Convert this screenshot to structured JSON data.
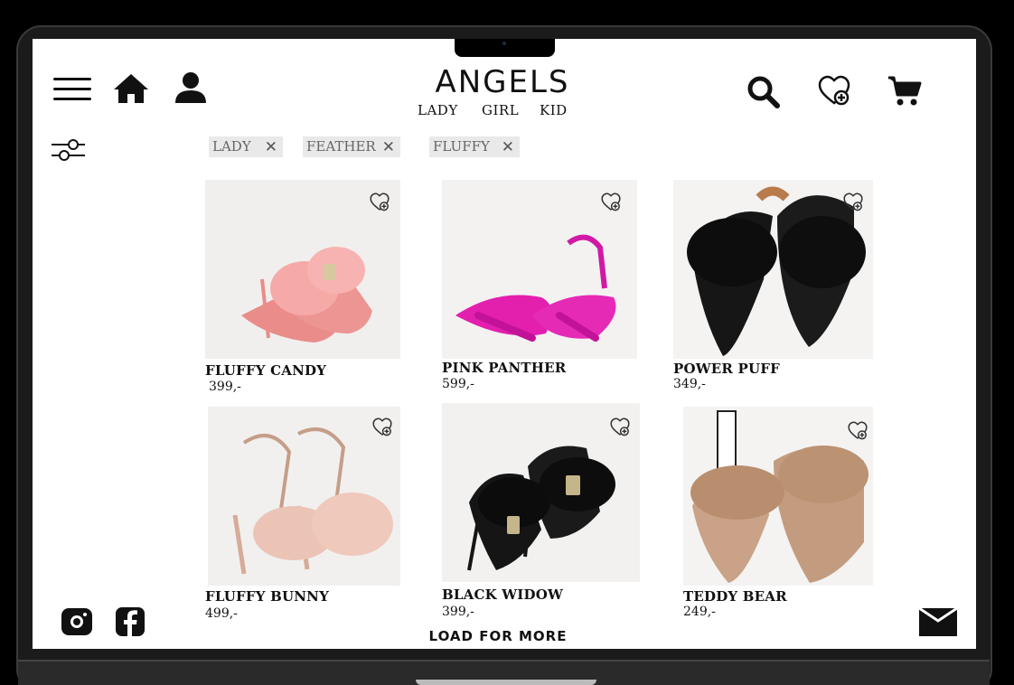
{
  "brand": {
    "logo": "ANGELS",
    "nav": [
      "LADY",
      "GIRL",
      "KID"
    ]
  },
  "icons": {
    "menu": "hamburger-icon",
    "home": "home-icon",
    "user": "user-icon",
    "search": "search-icon",
    "favorites": "heart-plus-icon",
    "cart": "cart-icon",
    "filters": "sliders-icon",
    "instagram": "instagram-icon",
    "facebook": "facebook-icon",
    "mail": "mail-icon"
  },
  "filters": [
    {
      "label": "LADY"
    },
    {
      "label": "FEATHER"
    },
    {
      "label": "FLUFFY"
    }
  ],
  "products": [
    {
      "name": "FLUFFY CANDY",
      "price": "399,-",
      "color": "#f2a1a0"
    },
    {
      "name": "PINK PANTHER",
      "price": "599,-",
      "color": "#e21ab0"
    },
    {
      "name": "POWER PUFF",
      "price": "349,-",
      "color": "#151515"
    },
    {
      "name": "FLUFFY BUNNY",
      "price": "499,-",
      "color": "#e6bfb0"
    },
    {
      "name": "BLACK WIDOW",
      "price": "399,-",
      "color": "#121212"
    },
    {
      "name": "TEDDY BEAR",
      "price": "249,-",
      "color": "#c9a287"
    }
  ],
  "load_more": "LOAD FOR MORE"
}
